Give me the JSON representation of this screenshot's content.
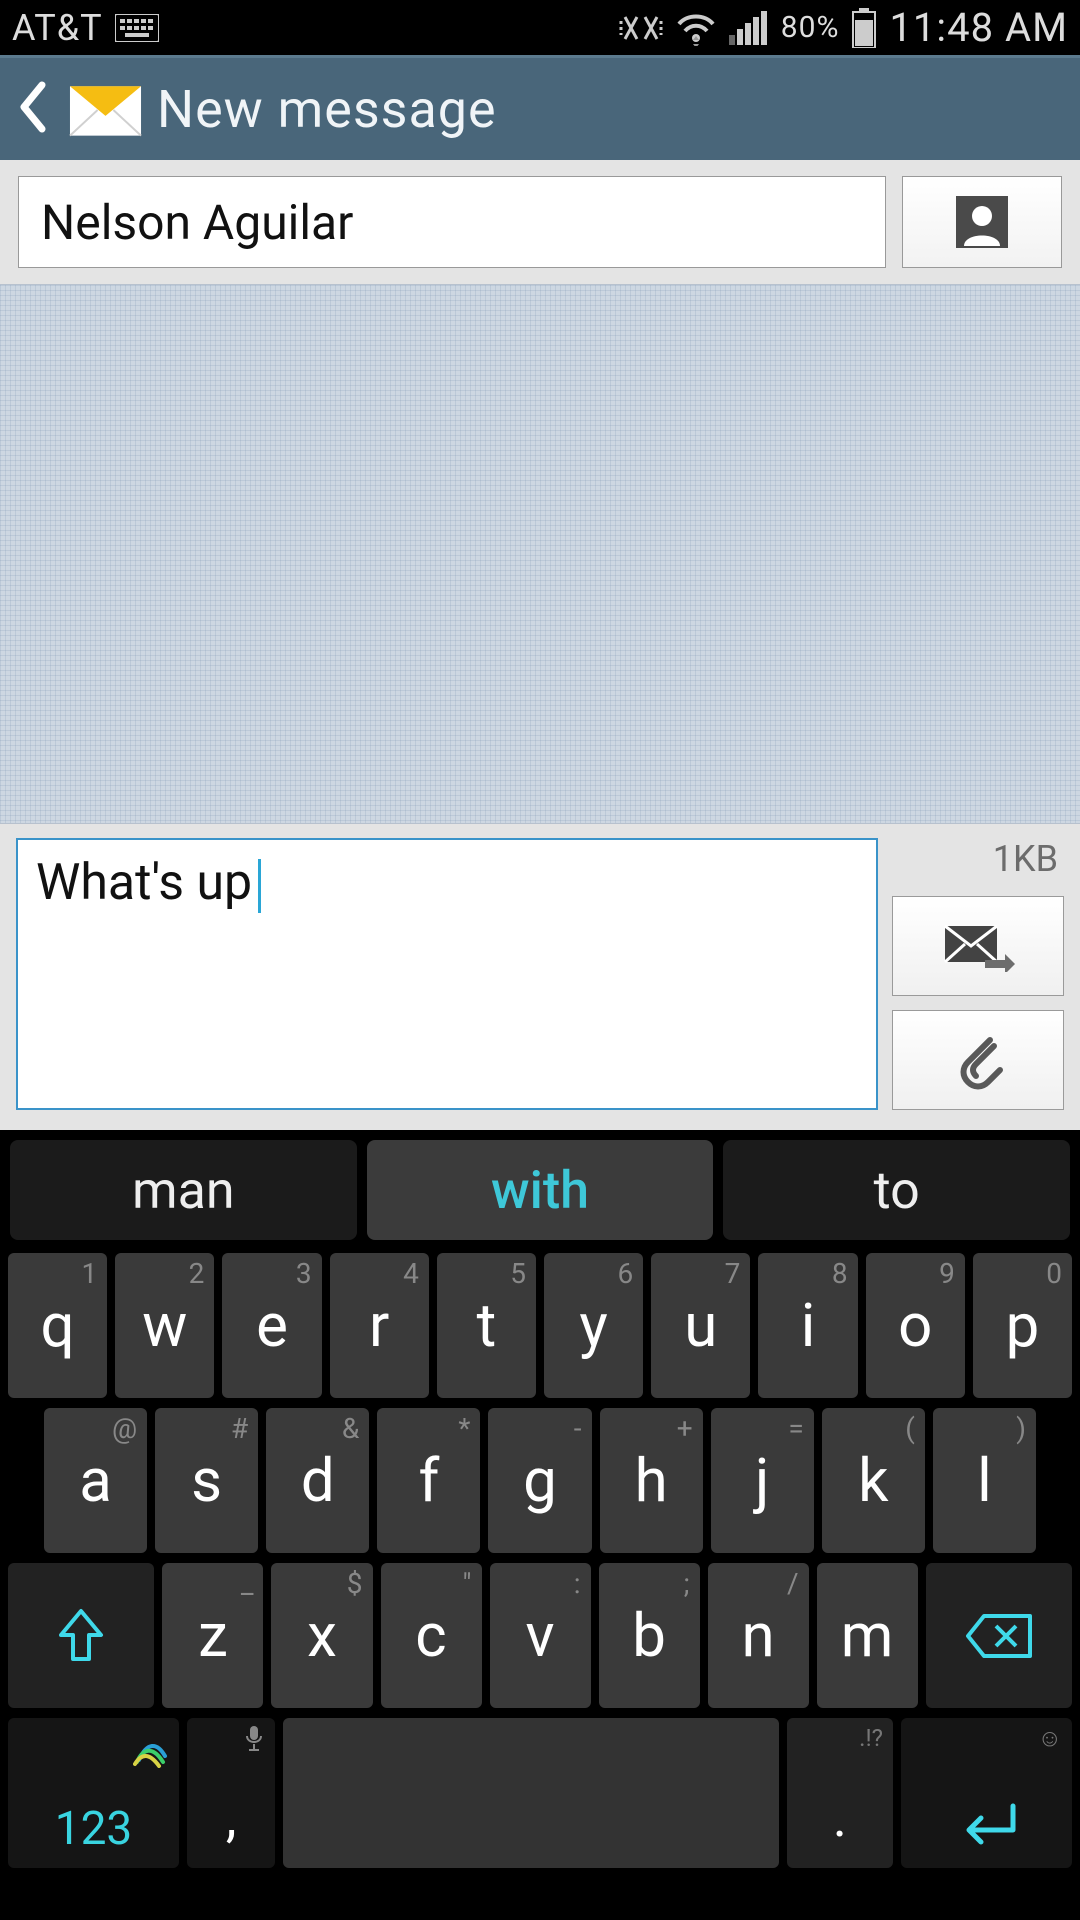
{
  "statusbar": {
    "carrier": "AT&T",
    "battery": "80%",
    "time": "11:48 AM"
  },
  "appbar": {
    "title": "New message"
  },
  "recipient": {
    "value": "Nelson Aguilar"
  },
  "compose": {
    "text": "What's up",
    "size": "1KB"
  },
  "suggestions": {
    "s1": "man",
    "s2": "with",
    "s3": "to"
  },
  "keys": {
    "r1": [
      {
        "main": "q",
        "alt": "1"
      },
      {
        "main": "w",
        "alt": "2"
      },
      {
        "main": "e",
        "alt": "3"
      },
      {
        "main": "r",
        "alt": "4"
      },
      {
        "main": "t",
        "alt": "5"
      },
      {
        "main": "y",
        "alt": "6"
      },
      {
        "main": "u",
        "alt": "7"
      },
      {
        "main": "i",
        "alt": "8"
      },
      {
        "main": "o",
        "alt": "9"
      },
      {
        "main": "p",
        "alt": "0"
      }
    ],
    "r2": [
      {
        "main": "a",
        "alt": "@"
      },
      {
        "main": "s",
        "alt": "#"
      },
      {
        "main": "d",
        "alt": "&"
      },
      {
        "main": "f",
        "alt": "*"
      },
      {
        "main": "g",
        "alt": "-"
      },
      {
        "main": "h",
        "alt": "+"
      },
      {
        "main": "j",
        "alt": "="
      },
      {
        "main": "k",
        "alt": "("
      },
      {
        "main": "l",
        "alt": ")"
      }
    ],
    "r3": [
      {
        "main": "z",
        "alt": "_"
      },
      {
        "main": "x",
        "alt": "$"
      },
      {
        "main": "c",
        "alt": "\""
      },
      {
        "main": "v",
        "alt": ":"
      },
      {
        "main": "b",
        "alt": ";"
      },
      {
        "main": "n",
        "alt": "/"
      },
      {
        "main": "m",
        "alt": ""
      }
    ],
    "numkey": "123",
    "comma": ",",
    "dot": ".",
    "dot_alt": ".!?",
    "smiley": "☺"
  }
}
